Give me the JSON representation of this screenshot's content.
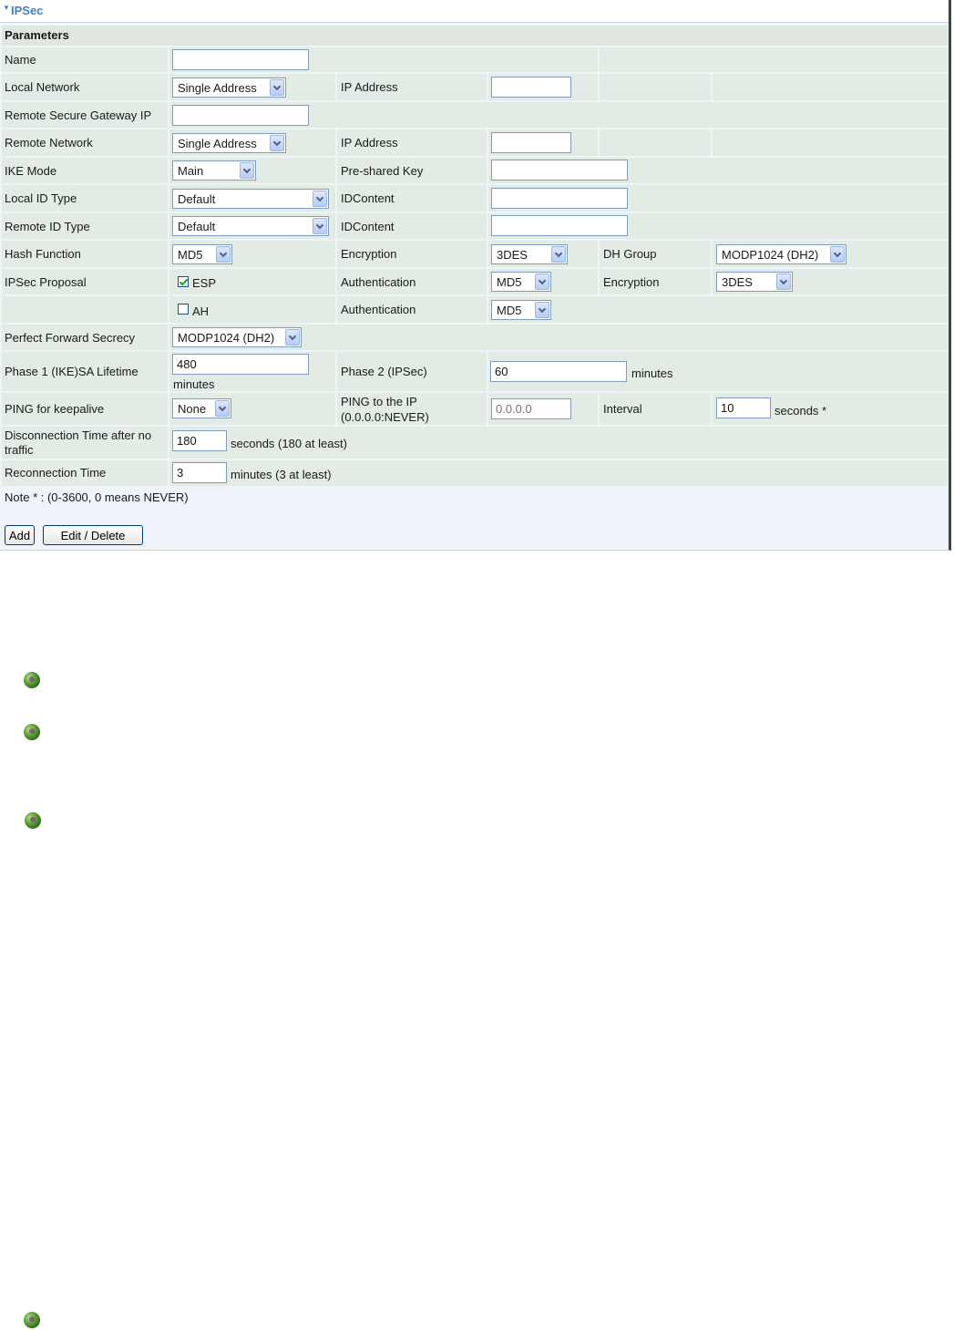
{
  "panel": {
    "title": "IPSec",
    "section": "Parameters"
  },
  "rows": {
    "name": {
      "label": "Name",
      "value": ""
    },
    "local_network": {
      "label": "Local Network",
      "select": "Single Address",
      "ip_label": "IP Address",
      "ip_value": ""
    },
    "remote_gateway": {
      "label": "Remote Secure Gateway IP",
      "value": ""
    },
    "remote_network": {
      "label": "Remote Network",
      "select": "Single Address",
      "ip_label": "IP Address",
      "ip_value": ""
    },
    "ike_mode": {
      "label": "IKE Mode",
      "select": "Main",
      "psk_label": "Pre-shared Key",
      "psk_value": ""
    },
    "local_id": {
      "label": "Local ID Type",
      "select": "Default",
      "content_label": "IDContent",
      "content_value": ""
    },
    "remote_id": {
      "label": "Remote ID Type",
      "select": "Default",
      "content_label": "IDContent",
      "content_value": ""
    },
    "hash": {
      "label": "Hash Function",
      "select": "MD5",
      "enc_label": "Encryption",
      "enc_select": "3DES",
      "dh_label": "DH Group",
      "dh_select": "MODP1024 (DH2)"
    },
    "proposal": {
      "label": "IPSec Proposal",
      "esp_label": "ESP",
      "esp_checked": true,
      "auth_label": "Authentication",
      "auth_select": "MD5",
      "enc_label": "Encryption",
      "enc_select": "3DES"
    },
    "ah": {
      "label": "AH",
      "checked": false,
      "auth_label": "Authentication",
      "auth_select": "MD5"
    },
    "pfs": {
      "label": "Perfect Forward Secrecy",
      "select": "MODP1024 (DH2)"
    },
    "lifetime": {
      "label": "Phase 1 (IKE)SA Lifetime",
      "p1_value": "480",
      "p1_unit": "minutes",
      "p2_label": "Phase 2 (IPSec)",
      "p2_value": "60",
      "p2_unit": "minutes"
    },
    "ping": {
      "label": "PING for keepalive",
      "select": "None",
      "ip_label_1": "PING to the IP",
      "ip_label_2": "(0.0.0.0:NEVER)",
      "ip_placeholder": "0.0.0.0",
      "interval_label": "Interval",
      "interval_value": "10",
      "interval_unit": "seconds *"
    },
    "disconnect": {
      "label_1": "Disconnection Time after no",
      "label_2": "traffic",
      "value": "180",
      "unit": "seconds (180 at least)"
    },
    "reconnect": {
      "label": "Reconnection Time",
      "value": "3",
      "unit": "minutes (3 at least)"
    },
    "note": {
      "text": "Note * : (0-3600, 0 means NEVER)"
    }
  },
  "buttons": {
    "add": "Add",
    "edit_delete": "Edit / Delete"
  },
  "bullets": [
    "globe-icon",
    "globe-icon",
    "globe-icon",
    "globe-icon"
  ]
}
